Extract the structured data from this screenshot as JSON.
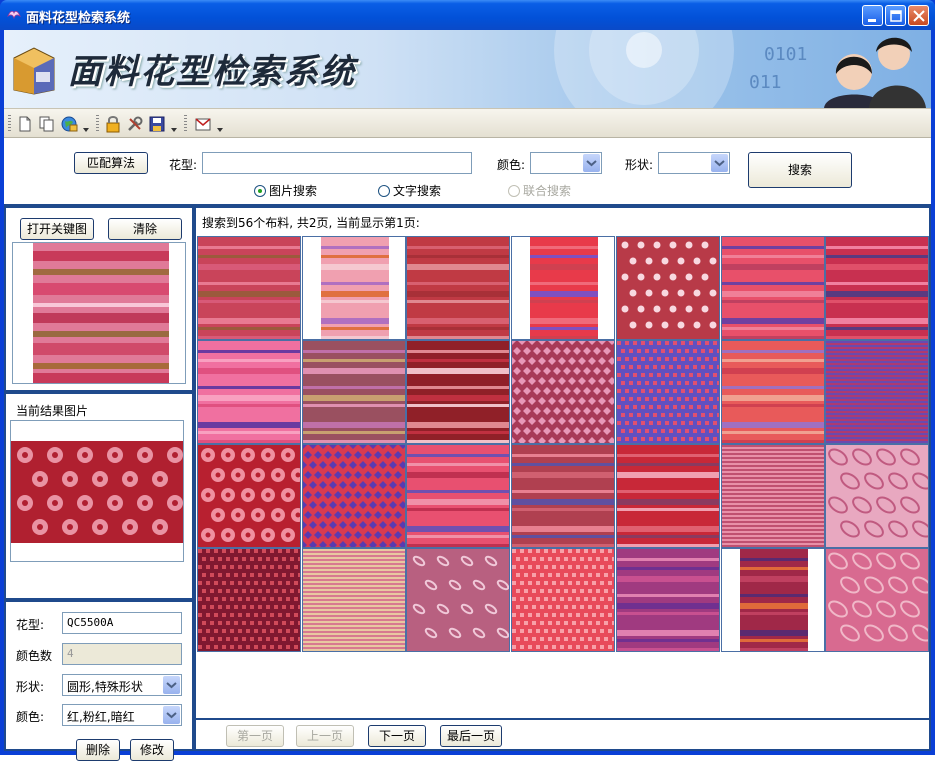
{
  "window": {
    "title": "面料花型检索系统"
  },
  "banner": {
    "title": "面料花型检索系统"
  },
  "toolbar": {
    "icons": [
      "new-file-icon",
      "copy-icon",
      "globe-icon",
      "lock-icon",
      "tools-icon",
      "save-icon",
      "mail-icon"
    ]
  },
  "search": {
    "match_button": "匹配算法",
    "pattern_label": "花型:",
    "pattern_value": "",
    "color_label": "颜色:",
    "color_value": "",
    "shape_label": "形状:",
    "shape_value": "",
    "search_button": "搜索",
    "radio_image": "图片搜索",
    "radio_text": "文字搜索",
    "radio_combined": "联合搜索",
    "selected_mode": "图片搜索"
  },
  "left": {
    "open_key_button": "打开关键图",
    "clear_button": "清除",
    "current_result_label": "当前结果图片",
    "pattern_label": "花型:",
    "pattern_value": "QC5500A",
    "color_count_label": "颜色数",
    "color_count_value": "4",
    "shape_label": "形状:",
    "shape_value": "圆形,特殊形状",
    "color_label": "颜色:",
    "color_value": "红,粉红,暗红",
    "delete_button": "删除",
    "edit_button": "修改"
  },
  "results": {
    "status": "搜索到56个布料, 共2页, 当前显示第1页:",
    "total": 56,
    "pages": 2,
    "current_page": 1,
    "thumbnails": [
      {
        "kind": "stripe",
        "colors": [
          "#c9445a",
          "#e87a92",
          "#9b5a3c",
          "#d85a78"
        ]
      },
      {
        "kind": "stripe-narrow",
        "colors": [
          "#f0a0b0",
          "#b070c0",
          "#e07040",
          "#f5c8d0"
        ]
      },
      {
        "kind": "stripe",
        "colors": [
          "#c03a44",
          "#d86070",
          "#a83038",
          "#e08890"
        ]
      },
      {
        "kind": "stripe-narrow",
        "colors": [
          "#e83a4a",
          "#f06a7a",
          "#8050c0",
          "#d04050"
        ]
      },
      {
        "kind": "dots",
        "colors": [
          "#b83a48",
          "#f8d8e0"
        ]
      },
      {
        "kind": "stripe",
        "colors": [
          "#e8506a",
          "#7040a0",
          "#f08098",
          "#c04060"
        ]
      },
      {
        "kind": "stripe",
        "colors": [
          "#c83050",
          "#f080a0",
          "#5a3a80",
          "#e0506a"
        ]
      },
      {
        "kind": "stripe",
        "colors": [
          "#f070a0",
          "#6a3aa0",
          "#f8a0c0",
          "#e05080"
        ]
      },
      {
        "kind": "stripe",
        "colors": [
          "#9a5060",
          "#c070a8",
          "#c8a070",
          "#e090b0"
        ]
      },
      {
        "kind": "stripe",
        "colors": [
          "#902028",
          "#e08890",
          "#c03040",
          "#f0c0c8"
        ]
      },
      {
        "kind": "diamond",
        "colors": [
          "#a83a58",
          "#e898b8"
        ]
      },
      {
        "kind": "check",
        "colors": [
          "#6050c0",
          "#e05070"
        ]
      },
      {
        "kind": "stripe",
        "colors": [
          "#e85a5a",
          "#a070c0",
          "#f0a090",
          "#d04050"
        ]
      },
      {
        "kind": "stripe-fine",
        "colors": [
          "#b03a70",
          "#6a4ab0"
        ]
      },
      {
        "kind": "flower",
        "colors": [
          "#b82030",
          "#f090a0"
        ]
      },
      {
        "kind": "diamond",
        "colors": [
          "#d83a50",
          "#5a3ab0"
        ]
      },
      {
        "kind": "stripe",
        "colors": [
          "#e85070",
          "#7050b0",
          "#f090a8",
          "#c03050"
        ]
      },
      {
        "kind": "stripe",
        "colors": [
          "#b04050",
          "#e88090",
          "#6050a0",
          "#d06070"
        ]
      },
      {
        "kind": "stripe",
        "colors": [
          "#c82838",
          "#e06070",
          "#8a3a60",
          "#f0a0b0"
        ]
      },
      {
        "kind": "stripe-fine",
        "colors": [
          "#e890a8",
          "#c05070"
        ]
      },
      {
        "kind": "paisley",
        "colors": [
          "#e8a8c0",
          "#c05a80"
        ]
      },
      {
        "kind": "check",
        "colors": [
          "#801830",
          "#d04a5a"
        ]
      },
      {
        "kind": "stripe-fine",
        "colors": [
          "#d87890",
          "#e8c8a0"
        ]
      },
      {
        "kind": "leaf",
        "colors": [
          "#b86080",
          "#f0c8d8"
        ]
      },
      {
        "kind": "check",
        "colors": [
          "#e84a5a",
          "#f8a0a8"
        ]
      },
      {
        "kind": "stripe",
        "colors": [
          "#a03a80",
          "#e080b0",
          "#703090",
          "#c85090"
        ]
      },
      {
        "kind": "stripe-narrow",
        "colors": [
          "#a02848",
          "#5a2a70",
          "#e06a3a",
          "#c04060"
        ]
      },
      {
        "kind": "paisley",
        "colors": [
          "#d86a90",
          "#f0b8c8"
        ]
      }
    ]
  },
  "pager": {
    "first": "第一页",
    "prev": "上一页",
    "next": "下一页",
    "last": "最后一页"
  },
  "colors": {
    "accent": "#1f4a8c",
    "titlebar": "#0251d8"
  }
}
